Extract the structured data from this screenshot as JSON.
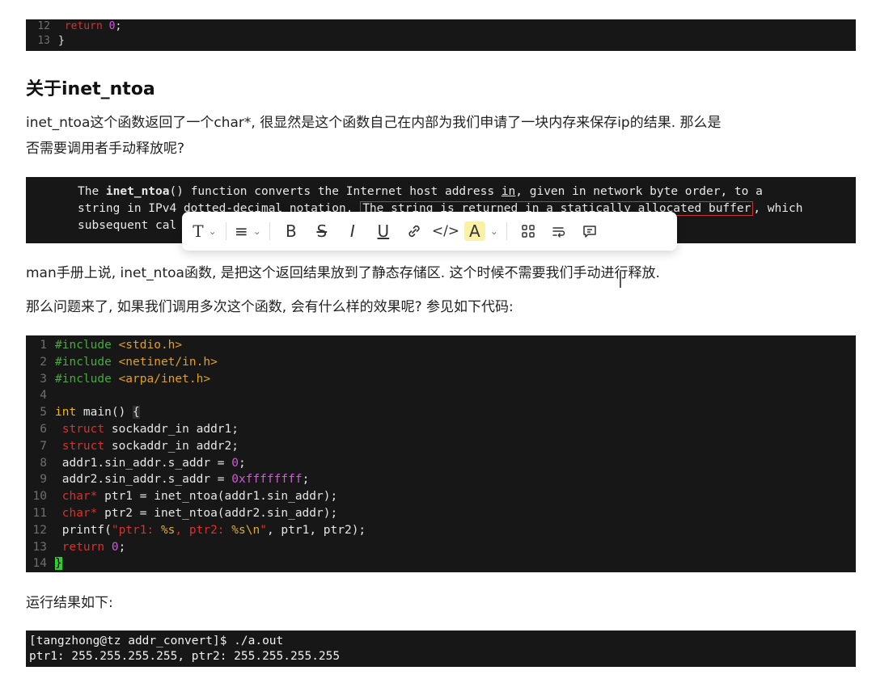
{
  "top_code": {
    "lines": [
      {
        "num": "12",
        "code": "  return 0;"
      },
      {
        "num": "13",
        "code": "}"
      }
    ]
  },
  "heading": "关于inet_ntoa",
  "para1_line1": "inet_ntoa这个函数返回了一个char*, 很显然是这个函数自己在内部为我们申请了一块内存来保存ip的结果. 那么是",
  "para1_line2": "否需要调用者手动释放呢?",
  "man": {
    "line1_pre": "The ",
    "line1_fn": "inet_ntoa",
    "line1_post": "() function converts the Internet host address ",
    "line1_in": "in",
    "line1_rest": ", given  in  network  byte  order,  to  a",
    "line2_pre": "string in IPv4 dotted-decimal notation.  ",
    "line2_box": "The string is returned in a statically allocated buffer",
    "line2_post": ", which",
    "line3": "subsequent cal"
  },
  "toolbar": {
    "text_style": "T",
    "align": "≡",
    "bold": "B",
    "strike": "S",
    "italic": "I",
    "underline": "U",
    "link": "🔗",
    "code": "</>",
    "highlight": "A",
    "grid": "⊞",
    "wrap": "⇉",
    "comment": "💬",
    "chevron": "⌄"
  },
  "para2": "man手册上说, inet_ntoa函数, 是把这个返回结果放到了静态存储区. 这个时候不需要我们手动进行释放.",
  "para3": "那么问题来了, 如果我们调用多次这个函数, 会有什么样的效果呢? 参见如下代码:",
  "main_code": {
    "l1": {
      "num": "1",
      "pp": "#include ",
      "hdr": "<stdio.h>"
    },
    "l2": {
      "num": "2",
      "pp": "#include ",
      "hdr": "<netinet/in.h>"
    },
    "l3": {
      "num": "3",
      "pp": "#include ",
      "hdr": "<arpa/inet.h>"
    },
    "l4": {
      "num": "4"
    },
    "l5": {
      "num": "5",
      "kw": "int",
      "rest": " main() ",
      "brace": "{"
    },
    "l6": {
      "num": "6",
      "kw": "struct",
      "rest": " sockaddr_in addr1;"
    },
    "l7": {
      "num": "7",
      "kw": "struct",
      "rest": " sockaddr_in addr2;"
    },
    "l8": {
      "num": "8",
      "pre": "addr1.sin_addr.s_addr = ",
      "val": "0",
      "post": ";"
    },
    "l9": {
      "num": "9",
      "pre": "addr2.sin_addr.s_addr = ",
      "val": "0xffffffff",
      "post": ";"
    },
    "l10": {
      "num": "10",
      "kw": "char",
      "kw2": "*",
      "rest": " ptr1 = inet_ntoa(addr1.sin_addr);"
    },
    "l11": {
      "num": "11",
      "kw": "char",
      "kw2": "*",
      "rest": " ptr2 = inet_ntoa(addr2.sin_addr);"
    },
    "l12": {
      "num": "12",
      "pre": "printf(",
      "s1": "\"ptr1: ",
      "f1": "%s",
      "s2": ", ptr2: ",
      "f2": "%s",
      "f3": "\\n",
      "s3": "\"",
      "post": ", ptr1, ptr2);"
    },
    "l13": {
      "num": "13",
      "kw": "return",
      "val": "0",
      "post": ";"
    },
    "l14": {
      "num": "14",
      "brace": "}"
    }
  },
  "para4": "运行结果如下:",
  "terminal": {
    "line1": "[tangzhong@tz addr_convert]$ ./a.out",
    "line2": "ptr1: 255.255.255.255, ptr2: 255.255.255.255"
  }
}
